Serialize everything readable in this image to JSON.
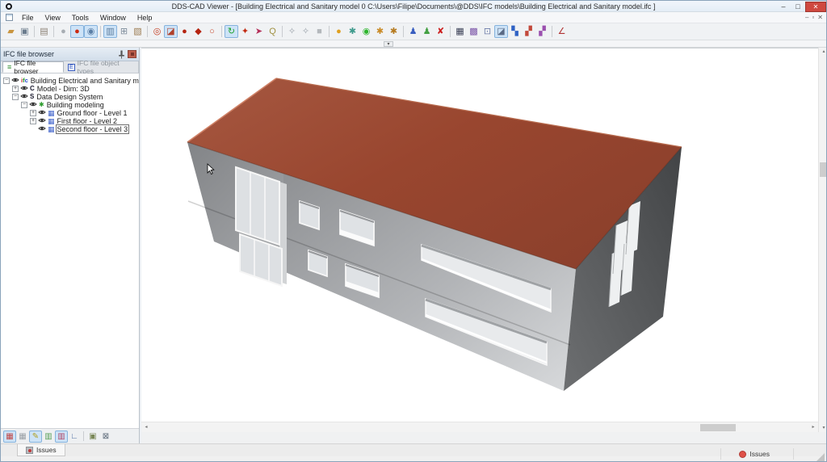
{
  "window": {
    "title": "DDS-CAD Viewer - [Building Electrical and Sanitary model  0  C:\\Users\\Filipe\\Documents\\@DDS\\IFC models\\Building Electrical and Sanitary model.ifc ]",
    "controls": {
      "minimize": "‒",
      "maximize": "□",
      "close": "✕"
    }
  },
  "menu": {
    "items": [
      "File",
      "View",
      "Tools",
      "Window",
      "Help"
    ],
    "mdi_controls": [
      "‒",
      "▫",
      "✕"
    ]
  },
  "toolbar": {
    "icons": [
      {
        "name": "open-file",
        "glyph": "▰",
        "color": "#c9953f"
      },
      {
        "name": "save-file",
        "glyph": "▣",
        "color": "#6b7c8d"
      },
      {
        "sep": true
      },
      {
        "name": "copy-view",
        "glyph": "▤",
        "color": "#8d8376"
      },
      {
        "sep": true
      },
      {
        "name": "view-sphere-gray",
        "glyph": "●",
        "color": "#a7adb3"
      },
      {
        "name": "view-sphere-red",
        "glyph": "●",
        "color": "#cc2b12",
        "active": true
      },
      {
        "name": "zoom-document",
        "glyph": "◉",
        "color": "#5b7fa6",
        "active": true
      },
      {
        "sep": true
      },
      {
        "name": "screenshot",
        "glyph": "▥",
        "color": "#5d7d9d",
        "active": true
      },
      {
        "name": "new-window",
        "glyph": "⊞",
        "color": "#7d8c9b"
      },
      {
        "name": "model-package",
        "glyph": "▧",
        "color": "#9c7c52"
      },
      {
        "sep": true
      },
      {
        "name": "red-donut",
        "glyph": "◎",
        "color": "#c43b1f"
      },
      {
        "name": "red-box-3d",
        "glyph": "◪",
        "color": "#b0402a",
        "active": true
      },
      {
        "name": "red-sphere",
        "glyph": "●",
        "color": "#b52410"
      },
      {
        "name": "red-cube",
        "glyph": "◆",
        "color": "#b52410"
      },
      {
        "name": "red-ring",
        "glyph": "○",
        "color": "#c94a30"
      },
      {
        "sep": true
      },
      {
        "name": "refresh-model",
        "glyph": "↻",
        "color": "#1fa32f",
        "active": true
      },
      {
        "name": "walk-mode",
        "glyph": "✦",
        "color": "#c22a12"
      },
      {
        "name": "fly-mode",
        "glyph": "➤",
        "color": "#b5305a"
      },
      {
        "name": "zoom-tool",
        "glyph": "Q",
        "color": "#a09040"
      },
      {
        "sep": true
      },
      {
        "name": "walk-person-1",
        "glyph": "✧",
        "color": "#9aa2aa"
      },
      {
        "name": "walk-person-2",
        "glyph": "✧",
        "color": "#9aa2aa"
      },
      {
        "name": "stop-box",
        "glyph": "■",
        "color": "#b4b8bc"
      },
      {
        "sep": true
      },
      {
        "name": "sun-position",
        "glyph": "●",
        "color": "#e0a01f"
      },
      {
        "name": "settings-gear",
        "glyph": "✱",
        "color": "#3d9a8c"
      },
      {
        "name": "sync-green",
        "glyph": "◉",
        "color": "#2db52d"
      },
      {
        "name": "gears-orange-1",
        "glyph": "✱",
        "color": "#c98a25"
      },
      {
        "name": "gears-orange-2",
        "glyph": "✱",
        "color": "#b57a1f"
      },
      {
        "sep": true
      },
      {
        "name": "person-blue",
        "glyph": "♟",
        "color": "#3a5fc0"
      },
      {
        "name": "person-green",
        "glyph": "♟",
        "color": "#44a044"
      },
      {
        "name": "delete-red",
        "glyph": "✘",
        "color": "#cc1d1d"
      },
      {
        "sep": true
      },
      {
        "name": "grid-dark",
        "glyph": "▦",
        "color": "#3a3f55"
      },
      {
        "name": "grid-purple",
        "glyph": "▩",
        "color": "#7b55a8"
      },
      {
        "name": "window-stack",
        "glyph": "⊡",
        "color": "#6b7ba8"
      },
      {
        "name": "view-3d-cube",
        "glyph": "◪",
        "color": "#5a6a85",
        "active": true
      },
      {
        "name": "chart-blue",
        "glyph": "▚",
        "color": "#2f62c4"
      },
      {
        "name": "chart-red-green",
        "glyph": "▞",
        "color": "#c2483a"
      },
      {
        "name": "chart-purple",
        "glyph": "▞",
        "color": "#9a4fae"
      },
      {
        "sep": true
      },
      {
        "name": "z-axis",
        "glyph": "∠",
        "color": "#b03333"
      }
    ],
    "combo_arrow": "▾"
  },
  "sidebar": {
    "header": {
      "title": "IFC file browser"
    },
    "tabs": [
      {
        "label": "IFC file browser",
        "active": true,
        "icon": "list-green"
      },
      {
        "label": "IFC file object types",
        "active": false,
        "icon": "e-blue"
      }
    ],
    "tree": [
      {
        "label": "Building Electrical and Sanitary model.ifc",
        "level": 0,
        "expander": "-",
        "icon": "ifc-logo",
        "selected": false
      },
      {
        "label": "Model - Dim: 3D",
        "level": 1,
        "expander": "+",
        "icon": "letter-c",
        "selected": false
      },
      {
        "label": "Data Design System",
        "level": 1,
        "expander": "-",
        "icon": "letter-s",
        "selected": false
      },
      {
        "label": "Building modeling",
        "level": 2,
        "expander": "-",
        "icon": "building",
        "selected": false
      },
      {
        "label": "Ground floor - Level 1",
        "level": 3,
        "expander": "+",
        "icon": "floor",
        "selected": false
      },
      {
        "label": "First floor - Level 2",
        "level": 3,
        "expander": "+",
        "icon": "floor",
        "selected": false
      },
      {
        "label": "Second floor - Level 3",
        "level": 3,
        "expander": null,
        "icon": "floor",
        "selected": true
      }
    ],
    "bottom_icons": [
      {
        "name": "view-plan",
        "glyph": "▦",
        "color": "#c04848",
        "active": true
      },
      {
        "name": "view-grid",
        "glyph": "▦",
        "color": "#9aa0a6"
      },
      {
        "name": "edit-pencil",
        "glyph": "✎",
        "color": "#b0a020",
        "active": true
      },
      {
        "name": "view-leaf",
        "glyph": "▥",
        "color": "#58a058"
      },
      {
        "name": "view-columns",
        "glyph": "▥",
        "color": "#b04868",
        "active": true
      },
      {
        "name": "view-chart",
        "glyph": "∟",
        "color": "#5878a8"
      },
      {
        "sep": true
      },
      {
        "name": "image-1",
        "glyph": "▣",
        "color": "#7a8858"
      },
      {
        "name": "image-2",
        "glyph": "⊠",
        "color": "#5a6878"
      }
    ]
  },
  "canvas": {
    "model_name": "Building Electrical and Sanitary model",
    "colors": {
      "roof": "#9a4a33",
      "wall_front": "#aeb0b3",
      "wall_left": "#8b8d90",
      "wall_right": "#4c4e50",
      "background": "#ffffff"
    },
    "scrollbars": {
      "h_left": "◂",
      "h_right": "▸",
      "v_up": "▴",
      "v_down": "▾"
    }
  },
  "bottom": {
    "issues_tab_label": "Issues",
    "status_issues_label": "Issues"
  }
}
